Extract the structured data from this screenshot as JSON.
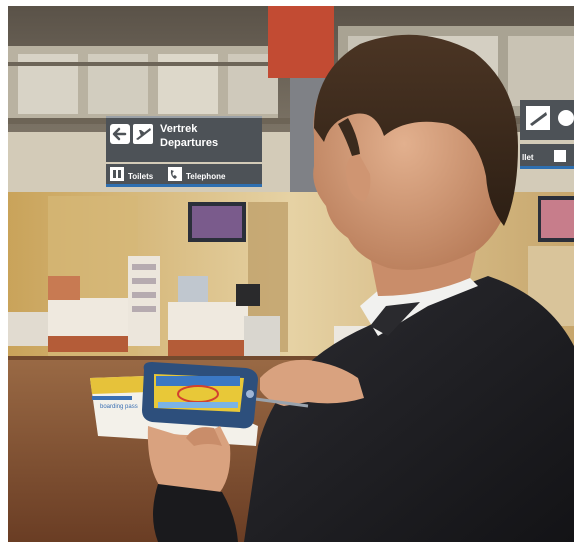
{
  "photo": {
    "scene": "airport-departures-hall",
    "signs": {
      "main": {
        "line1": "Vertrek",
        "line2": "Departures"
      },
      "sub": {
        "item1": "Toilets",
        "item2": "Telephone"
      },
      "right": {
        "partial_label": "llet"
      }
    },
    "boarding_pass": {
      "label": "boarding pass"
    },
    "colors": {
      "sign_bg": "#4d5257",
      "sign_stripe": "#2e6fb0",
      "floor": "#7a4a2c",
      "suit": "#1f1f22",
      "shirt": "#f1f1ef",
      "skin": "#d9a27f",
      "hair": "#3a2a1d",
      "device": "#2d4f7c",
      "device_screen": "#e8c838"
    },
    "icons": [
      "arrow-left-icon",
      "plane-departure-icon",
      "toilet-icon",
      "telephone-icon"
    ]
  }
}
